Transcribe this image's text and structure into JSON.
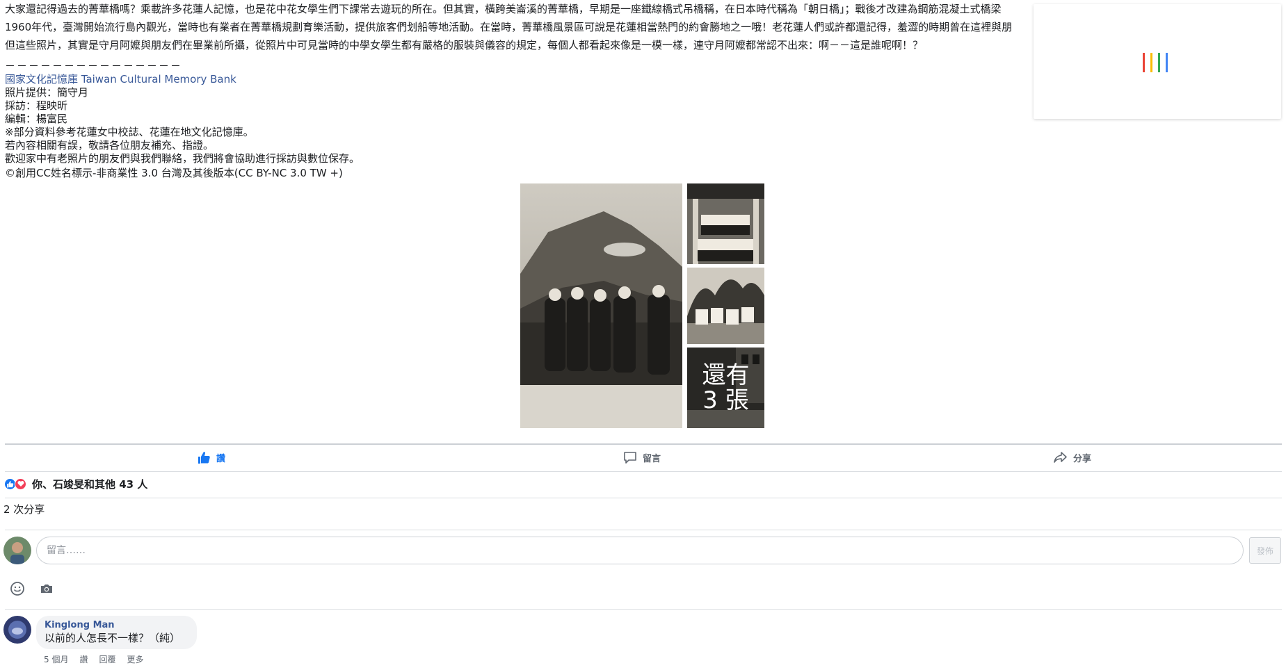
{
  "post": {
    "paragraphs": [
      "大家還記得過去的菁華橋嗎？乘載許多花蓮人記憶，也是花中花女學生們下課常去遊玩的所在。但其實，橫跨美崙溪的菁華橋，早期是一座鐵線橋式吊橋稱，在日本時代稱為「朝日橋」；戰後才改建為鋼筋混凝土式橋梁",
      "1960年代，臺灣開始流行島內觀光，當時也有業者在菁華橋規劃育樂活動，提供旅客們划船等地活動。在當時，菁華橋風景區可說是花蓮相當熱門的約會勝地之一哦！老花蓮人們或許都還記得，羞澀的時期曾在這裡與朋",
      "但這些照片，其實是守月阿嬤與朋友們在畢業前所攝，從照片中可見當時的中學女學生都有嚴格的服裝與儀容的規定，每個人都看起來像是一模一樣，連守月阿嬤都常認不出來：啊－－這是誰呢啊！？"
    ],
    "separator": "－－－－－－－－－－－－－－－",
    "source_link": "國家文化記憶庫 Taiwan Cultural Memory Bank",
    "credits": [
      "照片提供：簡守月",
      "採訪：程映昕",
      "編輯：楊富民",
      "※部分資料參考花蓮女中校誌、花蓮在地文化記憶庫。",
      "若內容相關有誤，敬請各位朋友補充、指證。",
      "歡迎家中有老照片的朋友們與我們聯絡，我們將會協助進行採訪與數位保存。",
      "©創用CC姓名標示-非商業性 3.0 台灣及其後版本(CC BY-NC 3.0 TW +)"
    ]
  },
  "photos": {
    "more_label": "還有 3 張"
  },
  "actions": {
    "like": "讚",
    "comment": "留言",
    "share": "分享"
  },
  "reactions": {
    "summary": "你、石竣旻和其他 43 人",
    "like_color": "#1877f2",
    "love_color": "#f33e58"
  },
  "shares": {
    "label": "2 次分享"
  },
  "composer": {
    "placeholder": "留言……",
    "post_label": "發佈"
  },
  "comments": [
    {
      "author": "Kinglong Man",
      "text": "以前的人怎長不一樣？（純）",
      "time": "5 個月",
      "like": "讚",
      "reply": "回覆",
      "more": "更多"
    }
  ],
  "loader_colors": [
    "#ea4335",
    "#fbbc05",
    "#34a853",
    "#4285f4"
  ]
}
